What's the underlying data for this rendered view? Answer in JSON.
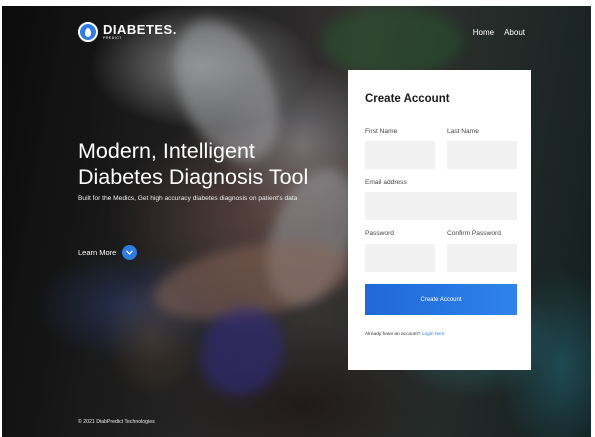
{
  "brand": {
    "name": "DIABETES.",
    "tagline": "PREDICT"
  },
  "nav": {
    "links": [
      "Home",
      "About"
    ]
  },
  "hero": {
    "title_line1": "Modern, Intelligent",
    "title_line2": "Diabetes Diagnosis Tool",
    "subtitle": "Built for the Medics, Get high accuracy diabetes diagnosis on patient's data",
    "cta_label": "Learn More",
    "cta_icon": "chevron-down-icon"
  },
  "form": {
    "title": "Create Account",
    "first_name_label": "First Name",
    "last_name_label": "Last Name",
    "email_label": "Email address",
    "password_label": "Password",
    "confirm_label": "Confirm Password",
    "first_name_value": "",
    "last_name_value": "",
    "email_value": "",
    "password_value": "",
    "confirm_value": "",
    "submit_label": "Create Account",
    "login_prompt": "Already have an account?",
    "login_link": "Login here"
  },
  "footer": {
    "text": "© 2021 DiabPredict Technologies"
  },
  "colors": {
    "accent": "#2f7de1",
    "card_bg": "#ffffff",
    "input_bg": "#f1f1f1"
  }
}
